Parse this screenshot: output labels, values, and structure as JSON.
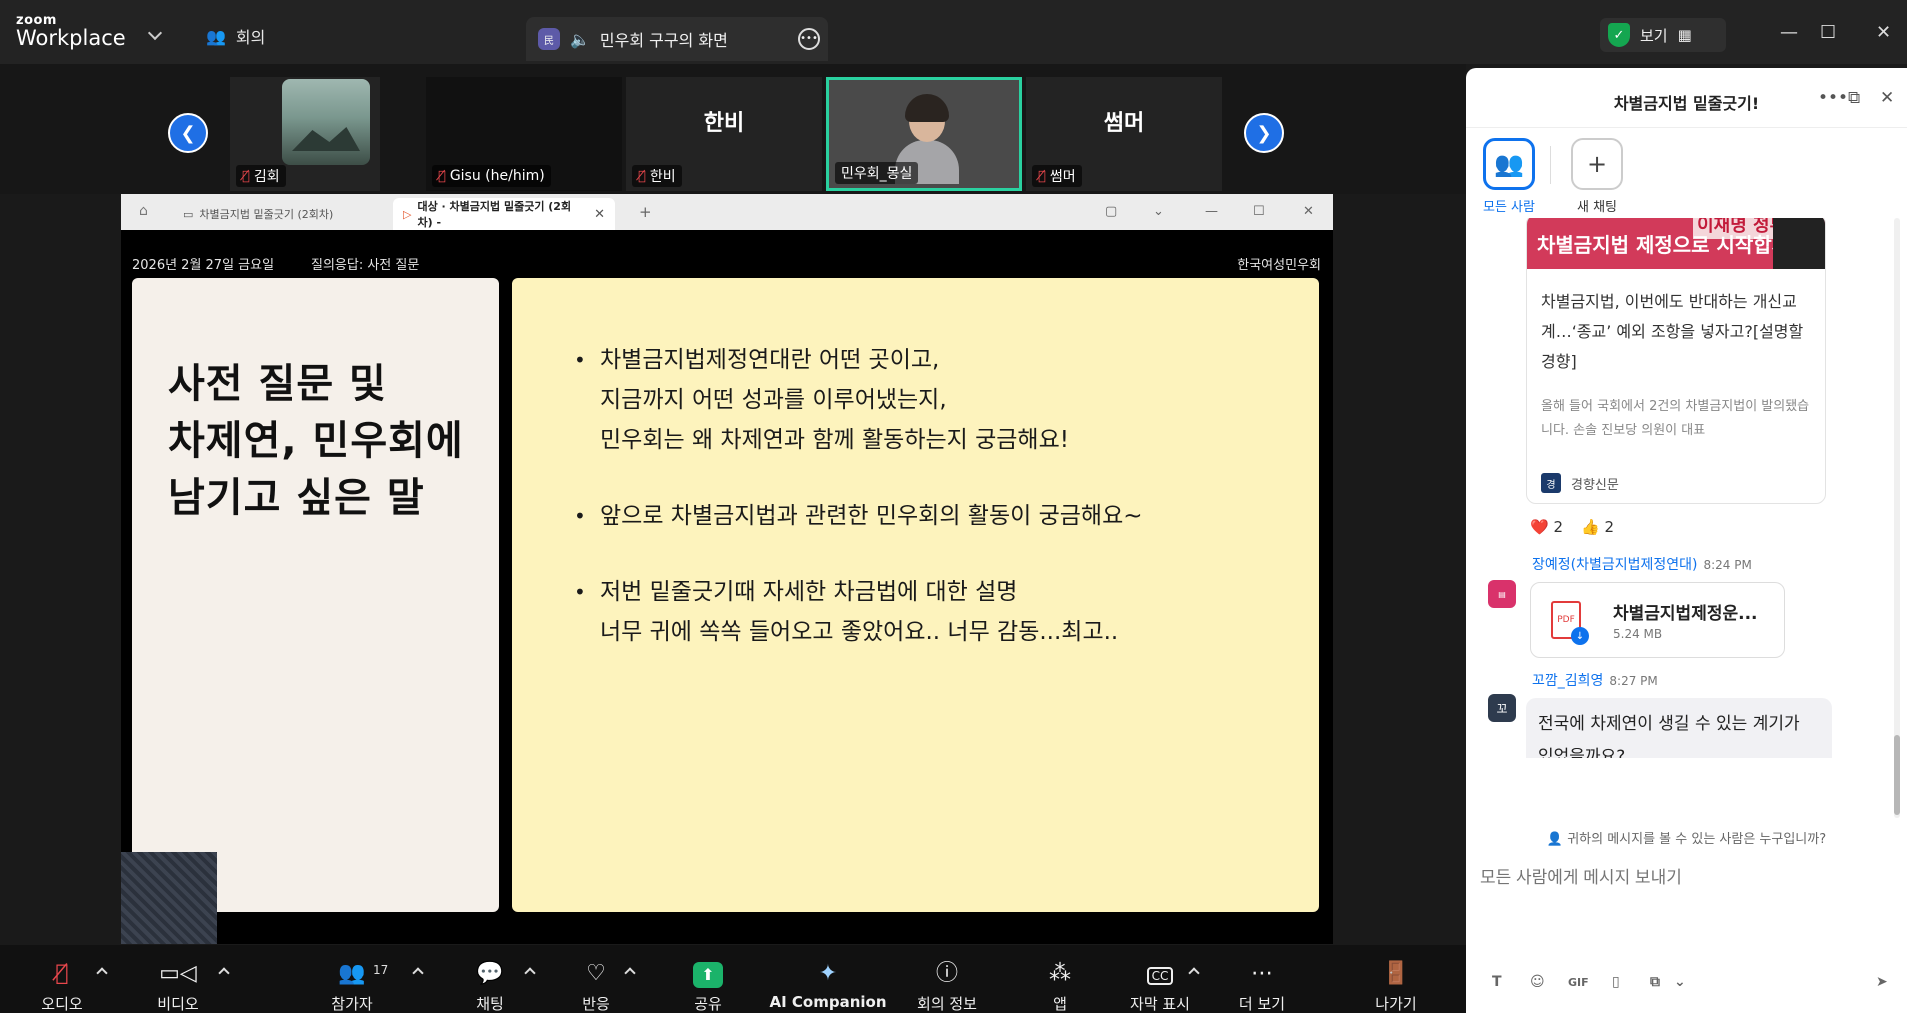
{
  "topbar": {
    "logo_line1": "zoom",
    "logo_line2": "Workplace",
    "meeting_tab_label": "회의",
    "share_tab_label": "민우회 구구의 화면",
    "view_label": "보기",
    "app_icon_text": "民"
  },
  "participants": [
    {
      "name": "김회",
      "big_name": "",
      "muted": true
    },
    {
      "name": "Gisu (he/him)",
      "big_name": "",
      "muted": true
    },
    {
      "name": "한비",
      "big_name": "한비",
      "muted": true
    },
    {
      "name": "민우회_몽실",
      "big_name": "",
      "muted": false
    },
    {
      "name": "썸머",
      "big_name": "썸머",
      "muted": true
    }
  ],
  "share_window": {
    "tab1_label": "차별금지법 밑줄긋기 (2회차)",
    "tab2_label": "대상 · 차별금지법 밑줄긋기 (2회차) -",
    "slide_date": "2026년 2월 27일 금요일",
    "slide_section": "질의응답: 사전 질문",
    "slide_org": "한국여성민우회",
    "left_title": [
      "사전 질문 및",
      "차제연, 민우회에",
      "남기고 싶은 말"
    ],
    "bullets": [
      "차별금지법제정연대란 어떤 곳이고,\n지금까지 어떤 성과를 이루어냈는지,\n민우회는 왜 차제연과 함께 활동하는지 궁금해요!",
      "앞으로 차별금지법과 관련한 민우회의 활동이 궁금해요~",
      "저번 밑줄긋기때 자세한 차금법에 대한 설명\n너무 귀에 쏙쏙 들어오고 좋았어요.. 너무 감동...최고.."
    ]
  },
  "chat": {
    "title": "차별금지법 밑줄긋기!",
    "channels": [
      {
        "label": "모든 사람",
        "active": true
      },
      {
        "label": "새 채팅",
        "active": false
      }
    ],
    "link_preview": {
      "image_text": "차별금지법 제정으로 시작합시다",
      "image_text2": "이재명 정부,",
      "title": "차별금지법, 이번에도 반대하는 개신교계…‘종교’ 예외 조항을 넣자고?[설명할경향]",
      "desc": "올해 들어 국회에서 2건의 차별금지법이 발의됐습니다. 손솔 진보당 의원이 대표",
      "source": "경향신문",
      "source_logo": "경"
    },
    "reactions": [
      {
        "emoji": "❤️",
        "count": "2"
      },
      {
        "emoji": "👍",
        "count": "2"
      }
    ],
    "messages": [
      {
        "sender": "장예정(차별금지법제정연대)",
        "time": "8:24 PM",
        "file_name": "차별금지법제정운...",
        "file_size": "5.24 MB"
      },
      {
        "sender": "꼬깜_김희영",
        "time": "8:27 PM",
        "avatar": "꼬",
        "text": "전국에 차제연이 생길 수 있는 계기가 있었을까요?"
      }
    ],
    "who_sees": "귀하의 메시지를 볼 수 있는 사람은 누구입니까?",
    "input_placeholder": "모든 사람에게 메시지 보내기",
    "format_gif": "GIF"
  },
  "toolbar": {
    "audio": "오디오",
    "video": "비디오",
    "participants": "참가자",
    "participants_count": "17",
    "chat": "채팅",
    "react": "반응",
    "share": "공유",
    "ai": "AI Companion",
    "info": "회의 정보",
    "apps": "앱",
    "captions": "자막 표시",
    "captions_icon": "CC",
    "more": "더 보기",
    "leave": "나가기"
  }
}
